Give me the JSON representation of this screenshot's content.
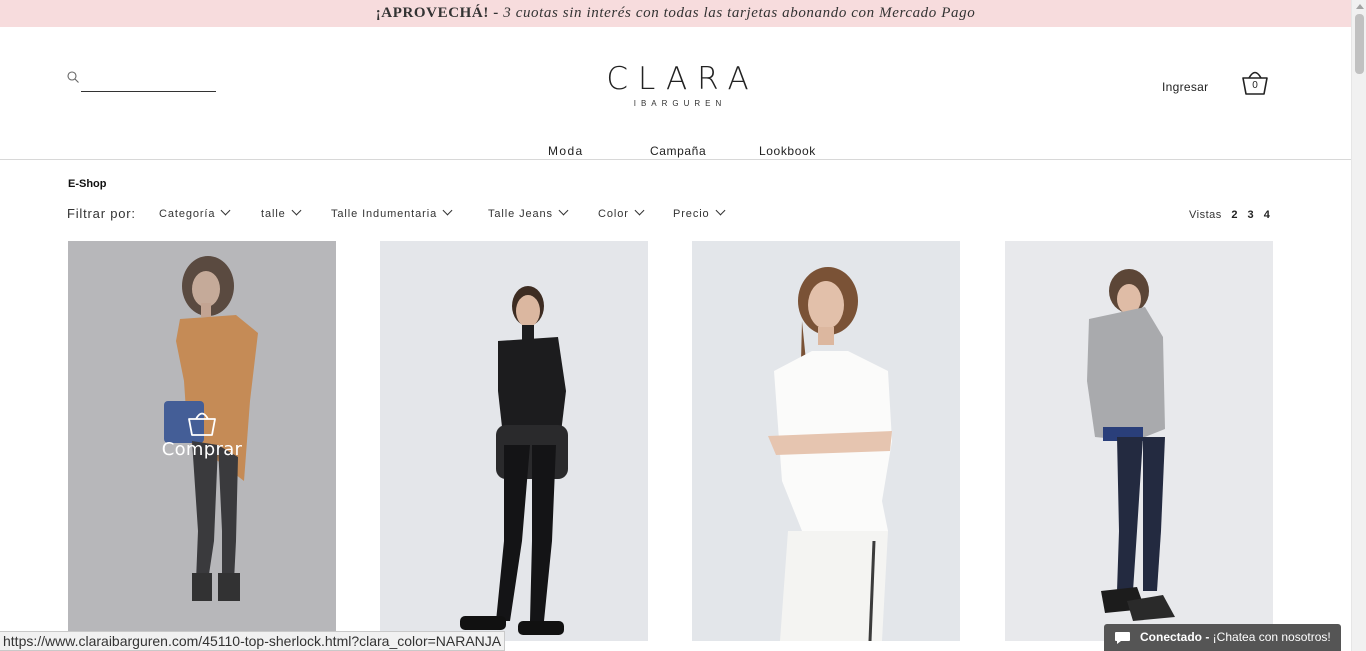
{
  "promo": {
    "strong": "¡APROVECHÁ! -",
    "text": " 3 cuotas sin interés con todas las tarjetas abonando con Mercado Pago"
  },
  "header": {
    "search_placeholder": "",
    "logo_main": "CLARA",
    "logo_sub": "IBARGUREN",
    "login_label": "Ingresar",
    "cart_count": "0"
  },
  "nav": {
    "items": [
      "Moda",
      "Campaña",
      "Lookbook"
    ]
  },
  "breadcrumb": "E-Shop",
  "filters": {
    "label": "Filtrar por:",
    "items": [
      "Categoría",
      "talle",
      "Talle Indumentaria",
      "Talle Jeans",
      "Color",
      "Precio"
    ]
  },
  "vistas": {
    "label": "Vistas",
    "options": [
      "2",
      "3",
      "4"
    ]
  },
  "products": [
    {
      "buy_label": "Comprar"
    },
    {},
    {},
    {}
  ],
  "status_url": "https://www.claraibarguren.com/45110-top-sherlock.html?clara_color=NARANJA",
  "chat": {
    "status": "Conectado -",
    "text": " ¡Chatea con nosotros!"
  },
  "colors": {
    "promo_bg": "#f7dcdd",
    "chat_bg": "#555555"
  }
}
